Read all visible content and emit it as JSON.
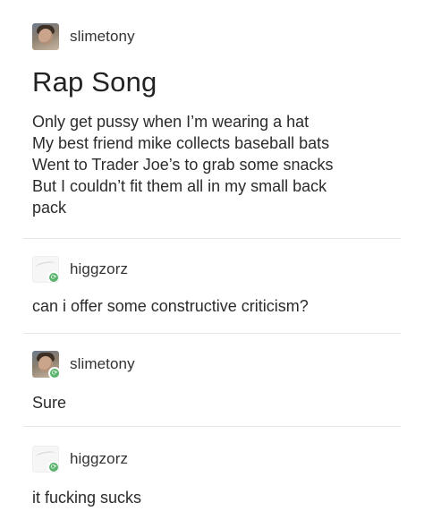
{
  "posts": [
    {
      "username": "slimetony",
      "avatar": "photo-avatar",
      "title": "Rap Song",
      "lines": [
        "Only get pussy when I’m wearing a hat",
        "My best friend mike collects baseball bats",
        "Went to Trader Joe’s to grab some snacks",
        "But I couldn’t fit them all in my small back",
        "pack"
      ]
    },
    {
      "username": "higgzorz",
      "avatar": "default-avatar",
      "reblog": "reblog-icon",
      "text": "can i offer some constructive criticism?"
    },
    {
      "username": "slimetony",
      "avatar": "photo-avatar",
      "reblog": "reblog-icon",
      "text": "Sure"
    },
    {
      "username": "higgzorz",
      "avatar": "default-avatar",
      "reblog": "reblog-icon",
      "text": "it fucking sucks"
    }
  ],
  "colors": {
    "reblog_green": "#59b36b",
    "text": "#2b2b2b",
    "divider": "#e7e7e7"
  }
}
